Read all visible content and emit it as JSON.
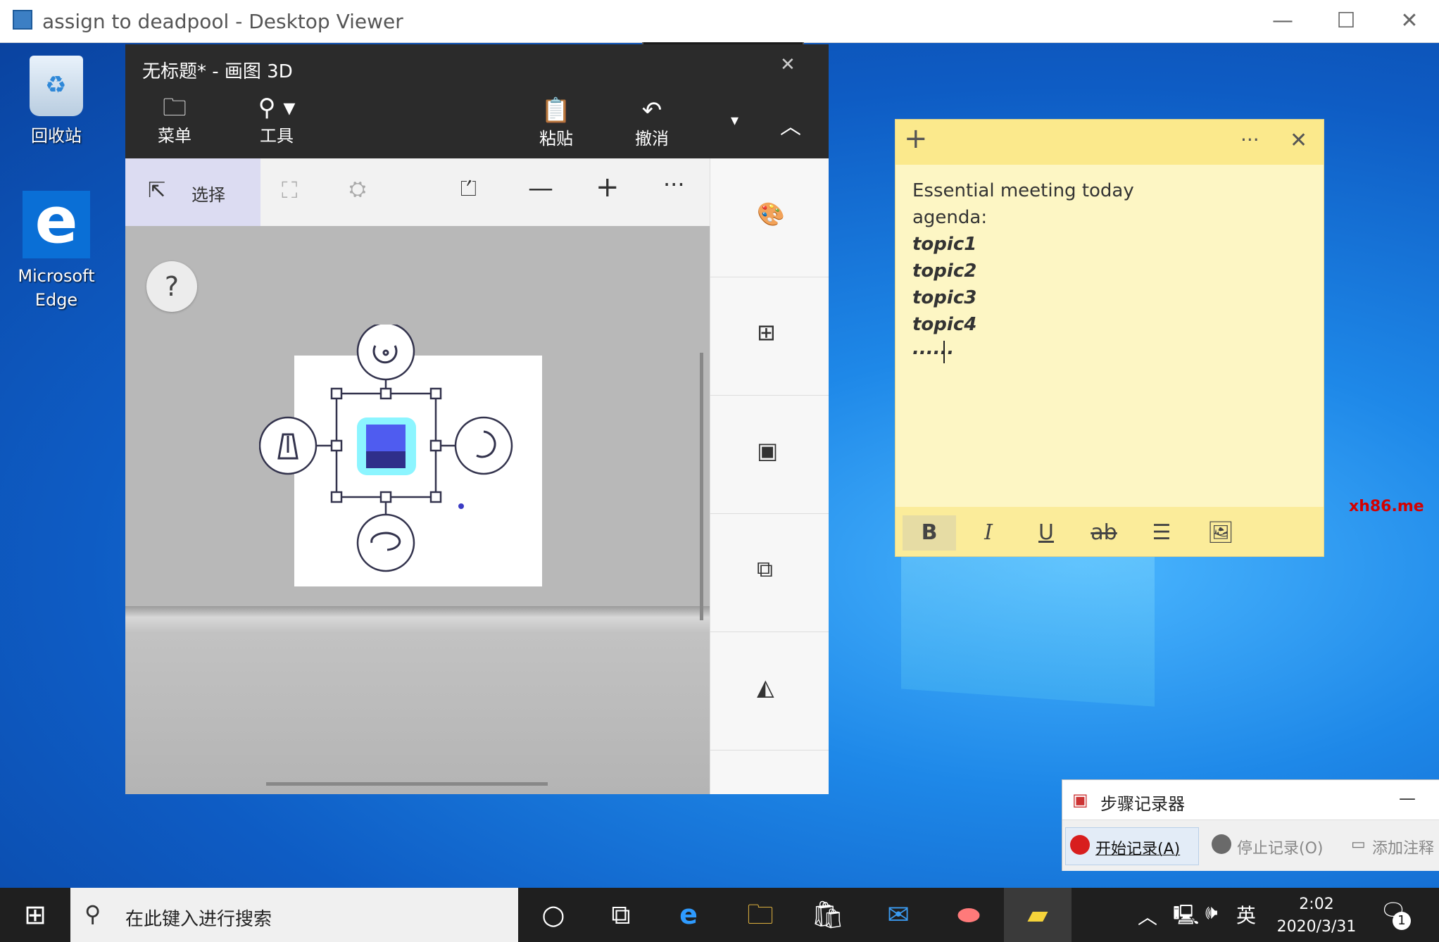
{
  "viewer": {
    "title": "assign to deadpool - Desktop Viewer",
    "minimize": "—",
    "maximize": "☐",
    "close": "✕"
  },
  "desktop": {
    "icons": [
      {
        "label": "回收站",
        "icon": "recycle-bin-icon"
      },
      {
        "label": "Microsoft Edge",
        "icon": "edge-icon"
      }
    ],
    "watermark": "xh86.me"
  },
  "paint3d": {
    "title": "无标题* - 画图 3D",
    "toolbar": {
      "menu_label": "菜单",
      "tools_label": "工具",
      "paste_label": "粘贴",
      "undo_label": "撤消"
    },
    "subtools": {
      "select_label": "选择",
      "help": "?"
    }
  },
  "sticky": {
    "lines": [
      "Essential meeting today",
      "agenda:"
    ],
    "topics": [
      "topic1",
      "topic2",
      "topic3",
      "topic4"
    ],
    "trailing": "......",
    "add": "+",
    "more": "···",
    "close": "✕",
    "format": {
      "bold": "B",
      "italic": "I",
      "underline": "U",
      "strike": "ab"
    }
  },
  "psr": {
    "title": "步骤记录器",
    "minimize": "—",
    "start_label": "开始记录(A)",
    "stop_label": "停止记录(O)",
    "comment_label": "添加注释"
  },
  "taskbar": {
    "search_placeholder": "在此键入进行搜索",
    "ime": "英",
    "time": "2:02",
    "date": "2020/3/31",
    "notification_count": "1"
  }
}
